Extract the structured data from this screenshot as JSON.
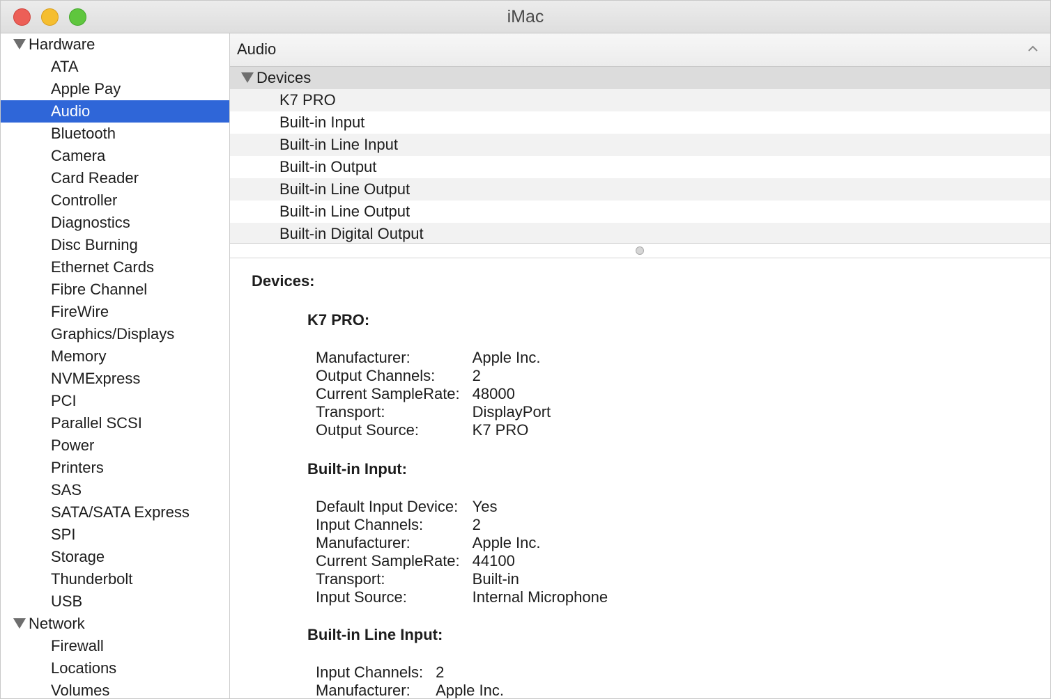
{
  "window": {
    "title": "iMac"
  },
  "sidebar": {
    "groups": [
      {
        "label": "Hardware",
        "items": [
          "ATA",
          "Apple Pay",
          "Audio",
          "Bluetooth",
          "Camera",
          "Card Reader",
          "Controller",
          "Diagnostics",
          "Disc Burning",
          "Ethernet Cards",
          "Fibre Channel",
          "FireWire",
          "Graphics/Displays",
          "Memory",
          "NVMExpress",
          "PCI",
          "Parallel SCSI",
          "Power",
          "Printers",
          "SAS",
          "SATA/SATA Express",
          "SPI",
          "Storage",
          "Thunderbolt",
          "USB"
        ]
      },
      {
        "label": "Network",
        "items": [
          "Firewall",
          "Locations",
          "Volumes"
        ]
      }
    ],
    "selected": "Audio"
  },
  "content": {
    "section_title": "Audio",
    "tree": {
      "group_label": "Devices",
      "items": [
        "K7 PRO",
        "Built-in Input",
        "Built-in Line Input",
        "Built-in Output",
        "Built-in Line Output",
        "Built-in Line Output",
        "Built-in Digital Output"
      ]
    },
    "detail": {
      "heading": "Devices:",
      "devices": [
        {
          "title": "K7 PRO:",
          "props": [
            {
              "key": "Manufacturer:",
              "value": "Apple Inc."
            },
            {
              "key": "Output Channels:",
              "value": "2"
            },
            {
              "key": "Current SampleRate:",
              "value": "48000"
            },
            {
              "key": "Transport:",
              "value": "DisplayPort"
            },
            {
              "key": "Output Source:",
              "value": "K7 PRO"
            }
          ]
        },
        {
          "title": "Built-in Input:",
          "props": [
            {
              "key": "Default Input Device:",
              "value": "Yes"
            },
            {
              "key": "Input Channels:",
              "value": "2"
            },
            {
              "key": "Manufacturer:",
              "value": "Apple Inc."
            },
            {
              "key": "Current SampleRate:",
              "value": "44100"
            },
            {
              "key": "Transport:",
              "value": "Built-in"
            },
            {
              "key": "Input Source:",
              "value": "Internal Microphone"
            }
          ]
        },
        {
          "title": "Built-in Line Input:",
          "props": [
            {
              "key": "Input Channels:",
              "value": "2"
            },
            {
              "key": "Manufacturer:",
              "value": "Apple Inc."
            }
          ]
        }
      ]
    }
  },
  "icons": {
    "close": "close-traffic-light-icon",
    "minimize": "minimize-traffic-light-icon",
    "zoom": "zoom-traffic-light-icon",
    "disclosure": "disclosure-triangle-icon",
    "collapse": "chevron-up-icon"
  },
  "colors": {
    "selection": "#2f66d8",
    "close": "#ec5f57",
    "minimize": "#f5be30",
    "zoom": "#5fc63e"
  }
}
